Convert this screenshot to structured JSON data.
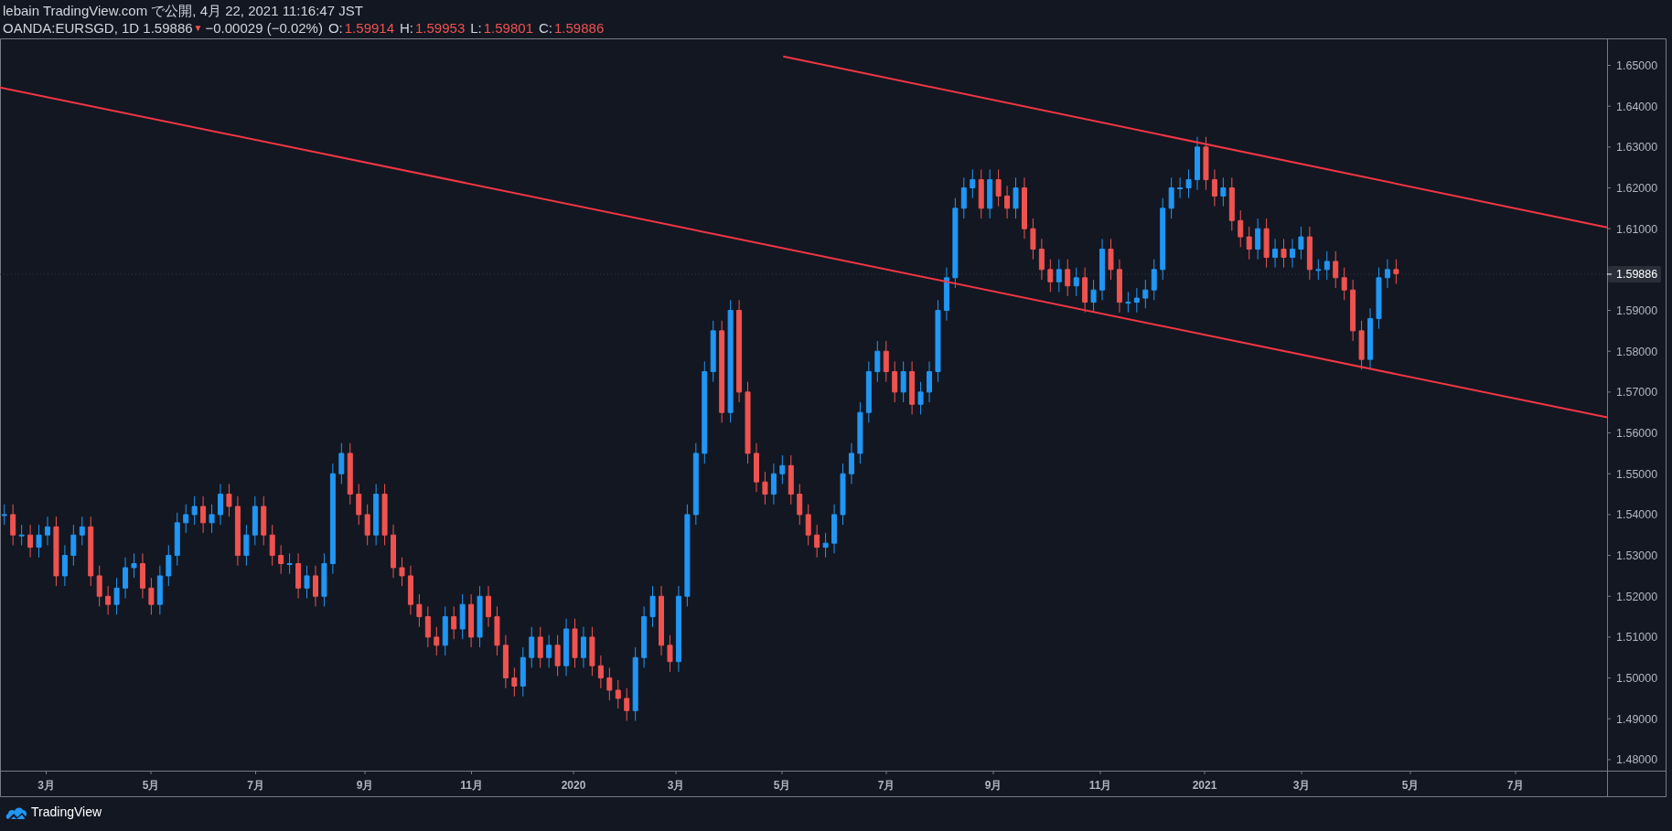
{
  "header": {
    "published": "lebain TradingView.com で公開, 4月 22, 2021 11:16:47 JST",
    "symbol": "OANDA:EURSGD, 1D 1.59886",
    "arrow": "▼",
    "change": "−0.00029 (−0.02%)",
    "ohlc": [
      {
        "label": "O:",
        "value": "1.59914"
      },
      {
        "label": "H:",
        "value": "1.59953"
      },
      {
        "label": "L:",
        "value": "1.59801"
      },
      {
        "label": "C:",
        "value": "1.59886"
      }
    ]
  },
  "price_axis": {
    "labels": [
      "1.65000",
      "1.64000",
      "1.63000",
      "1.62000",
      "1.61000",
      "1.59000",
      "1.58000",
      "1.57000",
      "1.56000",
      "1.55000",
      "1.54000",
      "1.53000",
      "1.52000",
      "1.51000",
      "1.50000",
      "1.49000",
      "1.48000"
    ],
    "last_price": "1.59886"
  },
  "time_axis": {
    "labels": [
      "3月",
      "5月",
      "7月",
      "9月",
      "11月",
      "2020",
      "3月",
      "5月",
      "7月",
      "9月",
      "11月",
      "2021",
      "3月",
      "5月",
      "7月"
    ]
  },
  "footer": {
    "brand": "TradingView"
  }
}
